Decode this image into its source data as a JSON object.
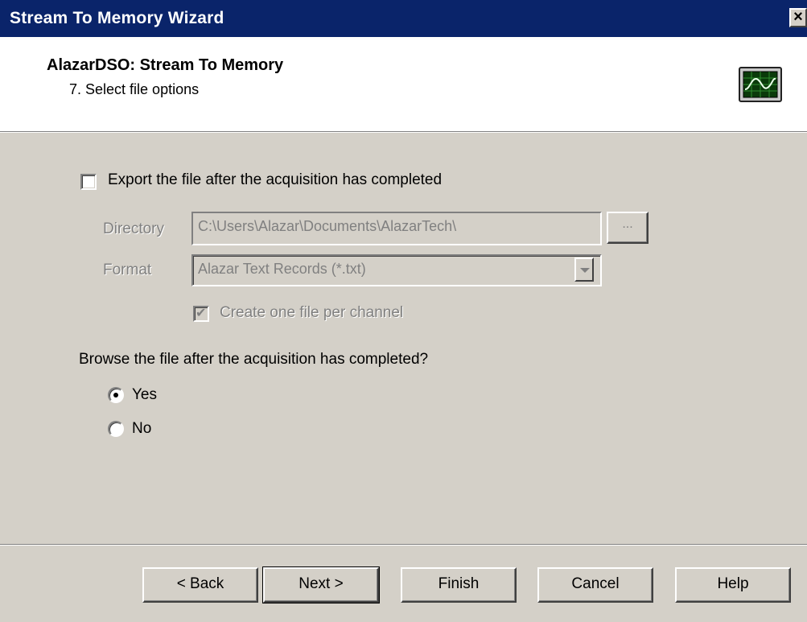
{
  "window": {
    "title": "Stream To Memory Wizard",
    "close_label": "×"
  },
  "header": {
    "title": "AlazarDSO: Stream To Memory",
    "step": "7. Select file options",
    "icon": "oscilloscope-icon"
  },
  "export": {
    "checkbox_label": "Export the file after the acquisition has completed",
    "checked": false,
    "directory_label": "Directory",
    "directory_value": "C:\\Users\\Alazar\\Documents\\AlazarTech\\",
    "browse_label": "...",
    "format_label": "Format",
    "format_value": "Alazar Text Records (*.txt)",
    "per_channel_label": "Create one file per channel",
    "per_channel_checked": true
  },
  "browse": {
    "question": "Browse the file after the acquisition has completed?",
    "options": [
      {
        "label": "Yes",
        "selected": true
      },
      {
        "label": "No",
        "selected": false
      }
    ]
  },
  "buttons": {
    "back": "< Back",
    "next": "Next >",
    "finish": "Finish",
    "cancel": "Cancel",
    "help": "Help"
  }
}
